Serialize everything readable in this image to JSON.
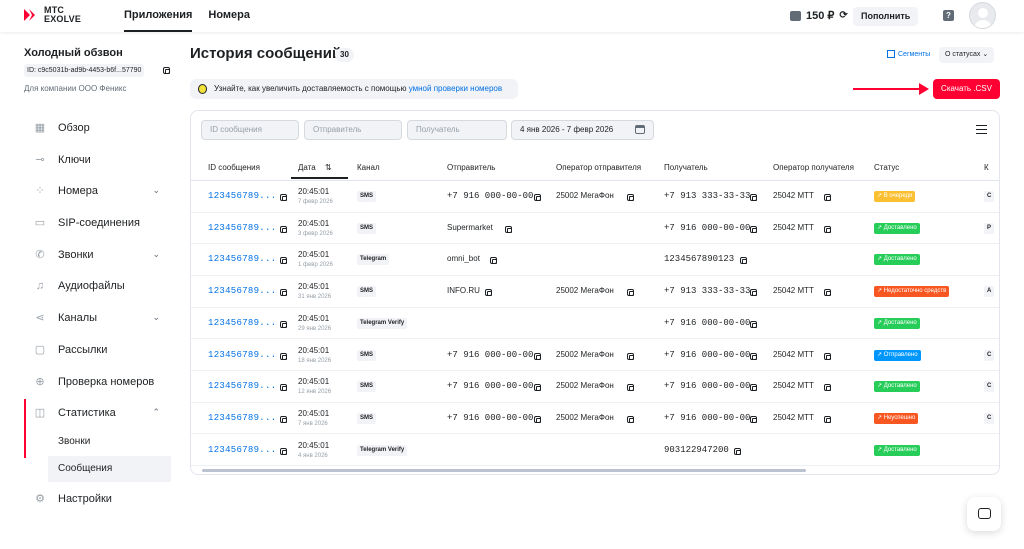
{
  "brand": {
    "line1": "МТС",
    "line2": "EXOLVE",
    "accent": "#ff0032"
  },
  "topnav": [
    {
      "label": "Приложения",
      "active": true
    },
    {
      "label": "Номера",
      "active": false
    }
  ],
  "balance": {
    "amount": "150 ₽",
    "topup_label": "Пополнить"
  },
  "project": {
    "name": "Холодный обзвон",
    "id": "ID: c9c5031b-ad9b-4453-b6f...57790",
    "company": "Для компании ООО Феникс"
  },
  "sidebar": {
    "items": [
      {
        "label": "Обзор",
        "icon": "grid-icon"
      },
      {
        "label": "Ключи",
        "icon": "key-icon"
      },
      {
        "label": "Номера",
        "icon": "dots-icon"
      },
      {
        "label": "SIP-соединения",
        "icon": "sip-icon"
      },
      {
        "label": "Звонки",
        "icon": "phone-icon"
      },
      {
        "label": "Аудиофайлы",
        "icon": "music-icon"
      },
      {
        "label": "Каналы",
        "icon": "share-icon"
      },
      {
        "label": "Рассылки",
        "icon": "chat-icon"
      },
      {
        "label": "Проверка номеров",
        "icon": "target-icon"
      },
      {
        "label": "Статистика",
        "icon": "chart-icon"
      },
      {
        "label": "Настройки",
        "icon": "gear-icon"
      }
    ],
    "subitems": [
      {
        "label": "Звонки"
      },
      {
        "label": "Сообщения"
      }
    ]
  },
  "page": {
    "title": "История сообщений",
    "count": "30",
    "segments": "Сегменты",
    "status_filter": "О статусах"
  },
  "banner": {
    "text": "Узнайте, как увеличить доставляемость с помощью ",
    "link": "умной проверки номеров"
  },
  "csv_button": "Скачать .CSV",
  "filters": {
    "id_placeholder": "ID сообщения",
    "sender_placeholder": "Отправитель",
    "recipient_placeholder": "Получатель",
    "date_range": "4 янв 2026 - 7 февр 2026"
  },
  "table": {
    "headers": [
      "ID сообщения",
      "Дата",
      "Канал",
      "Отправитель",
      "Оператор отправителя",
      "Получатель",
      "Оператор получателя",
      "Статус",
      "К"
    ],
    "rows": [
      {
        "id": "123456789...",
        "time": "20:45:01",
        "date": "7 февр 2026",
        "channel": "SMS",
        "sender": "+7 916 000-00-00",
        "sender_mono": true,
        "sender_op": "25002 МегаФон",
        "recipient": "+7 913 333-33-33",
        "recipient_op": "25042 МТТ",
        "status": "В очереди",
        "status_color": "#fac031",
        "extra": "С"
      },
      {
        "id": "123456789...",
        "time": "20:45:01",
        "date": "3 февр 2026",
        "channel": "SMS",
        "sender": "Supermarket",
        "sender_mono": false,
        "sender_op": "",
        "recipient": "+7 916 000-00-00",
        "recipient_op": "25042 МТТ",
        "status": "Доставлено",
        "status_color": "#26cd58",
        "extra": "Р"
      },
      {
        "id": "123456789...",
        "time": "20:45:01",
        "date": "1 февр 2026",
        "channel": "Telegram",
        "sender": "omni_bot",
        "sender_mono": false,
        "sender_op": "",
        "recipient": "1234567890123",
        "recipient_op": "",
        "status": "Доставлено",
        "status_color": "#26cd58",
        "extra": ""
      },
      {
        "id": "123456789...",
        "time": "20:45:01",
        "date": "31 янв 2026",
        "channel": "SMS",
        "sender": "INFO.RU",
        "sender_mono": false,
        "sender_op": "25002 МегаФон",
        "recipient": "+7 913 333-33-33",
        "recipient_op": "25042 МТТ",
        "status": "Недостаточно средств",
        "status_color": "#f95721",
        "extra": "А"
      },
      {
        "id": "123456789...",
        "time": "20:45:01",
        "date": "29 янв 2026",
        "channel": "Telegram Verify",
        "sender": "",
        "sender_mono": false,
        "sender_op": "",
        "recipient": "+7 916 000-00-00",
        "recipient_op": "",
        "status": "Доставлено",
        "status_color": "#26cd58",
        "extra": ""
      },
      {
        "id": "123456789...",
        "time": "20:45:01",
        "date": "18 янв 2026",
        "channel": "SMS",
        "sender": "+7 916 000-00-00",
        "sender_mono": true,
        "sender_op": "25002 МегаФон",
        "recipient": "+7 916 000-00-00",
        "recipient_op": "25042 МТТ",
        "status": "Отправлено",
        "status_color": "#0097fd",
        "extra": "С"
      },
      {
        "id": "123456789...",
        "time": "20:45:01",
        "date": "12 янв 2026",
        "channel": "SMS",
        "sender": "+7 916 000-00-00",
        "sender_mono": true,
        "sender_op": "25002 МегаФон",
        "recipient": "+7 916 000-00-00",
        "recipient_op": "25042 МТТ",
        "status": "Доставлено",
        "status_color": "#26cd58",
        "extra": "С"
      },
      {
        "id": "123456789...",
        "time": "20:45:01",
        "date": "7 янв 2026",
        "channel": "SMS",
        "sender": "+7 916 000-00-00",
        "sender_mono": true,
        "sender_op": "25002 МегаФон",
        "recipient": "+7 916 000-00-00",
        "recipient_op": "25042 МТТ",
        "status": "Неуспешно",
        "status_color": "#f95721",
        "extra": "С"
      },
      {
        "id": "123456789...",
        "time": "20:45:01",
        "date": "4 янв 2026",
        "channel": "Telegram Verify",
        "sender": "",
        "sender_mono": false,
        "sender_op": "",
        "recipient": "903122947200",
        "recipient_op": "",
        "status": "Доставлено",
        "status_color": "#26cd58",
        "extra": ""
      }
    ]
  }
}
